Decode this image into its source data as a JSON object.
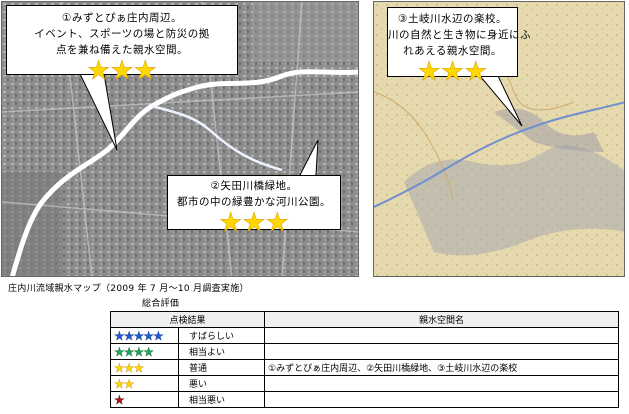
{
  "colors": {
    "urban_map_bg": "#8a8a8a",
    "topo_map_bg": "#e8dcb0",
    "river": "#ffffff",
    "star_gold": "#ffd800",
    "star_blue": "#1f5bd8",
    "star_green": "#1fa85a",
    "star_red": "#b01010"
  },
  "callouts": [
    {
      "lines": [
        "①みずとぴぁ庄内周辺。",
        "イベント、スポーツの場と防災の拠",
        "点を兼ね備えた親水空間。"
      ],
      "stars": "★★★"
    },
    {
      "lines": [
        "②矢田川橋緑地。",
        "都市の中の緑豊かな河川公園。"
      ],
      "stars": "★★★"
    },
    {
      "lines": [
        "③土岐川水辺の楽校。",
        "川の自然と生き物に身近にふ",
        "れあえる親水空間。"
      ],
      "stars": "★★★"
    }
  ],
  "map_caption": "庄内川流域親水マップ（2009 年 7 月～10 月調査実施）",
  "legend": {
    "title": "総合評価",
    "header_result": "点検結果",
    "header_spaces": "親水空間名",
    "rows": [
      {
        "stars": "★★★★★",
        "star_color": "blue",
        "label": "すばらしい",
        "spaces": ""
      },
      {
        "stars": "★★★★",
        "star_color": "green",
        "label": "相当よい",
        "spaces": ""
      },
      {
        "stars": "★★★",
        "star_color": "yellow",
        "label": "普通",
        "spaces": "①みずとぴぁ庄内周辺、②矢田川橋緑地、③土岐川水辺の楽校"
      },
      {
        "stars": "★★",
        "star_color": "yellow",
        "label": "悪い",
        "spaces": ""
      },
      {
        "stars": "★",
        "star_color": "red",
        "label": "相当悪い",
        "spaces": ""
      }
    ]
  }
}
